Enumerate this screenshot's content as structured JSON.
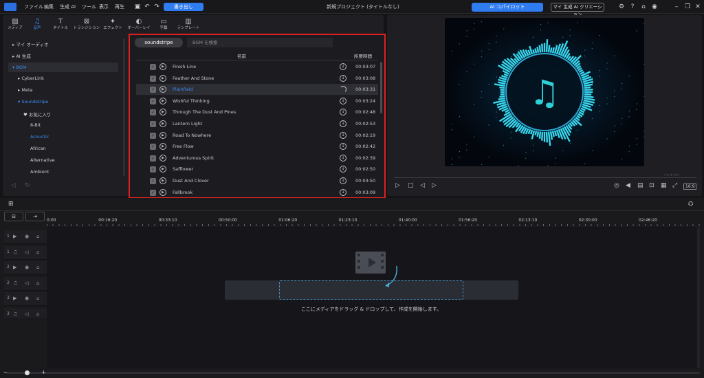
{
  "menu": [
    "ファイル",
    "編集",
    "生成 AI",
    "ツール",
    "表示",
    "再生"
  ],
  "toolbar": {
    "export_label": "書き出し"
  },
  "project_title": "新規プロジェクト (タイトルなし)",
  "ai_copilot_label": "AI コパイロット",
  "ai_creation_label": "マイ 生成 AI クリエーション",
  "tabs": [
    {
      "label": "メディア"
    },
    {
      "label": "音声"
    },
    {
      "label": "タイトル"
    },
    {
      "label": "トランジション"
    },
    {
      "label": "エフェクト"
    },
    {
      "label": "オーバーレイ"
    },
    {
      "label": "字幕"
    },
    {
      "label": "テンプレート"
    }
  ],
  "tree": [
    "マイ オーディオ",
    "AI 生成",
    "BGM",
    "CyberLink",
    "Meta",
    "Soundstripe",
    "お気に入り",
    "8-Bit",
    "Acoustic",
    "African",
    "Alternative",
    "Ambient"
  ],
  "music": {
    "brand": "soundstripe",
    "search_placeholder": "BGM を検索",
    "col_name": "名前",
    "col_duration": "所要時間",
    "rows": [
      {
        "name": "Finish Line",
        "dur": "00:03:07"
      },
      {
        "name": "Feather And Stone",
        "dur": "00:03:08"
      },
      {
        "name": "Plainfield",
        "dur": "00:03:31"
      },
      {
        "name": "Wishful Thinking",
        "dur": "00:03:24"
      },
      {
        "name": "Through The Dust And Pines",
        "dur": "00:02:48"
      },
      {
        "name": "Lantern Light",
        "dur": "00:02:53"
      },
      {
        "name": "Road To Nowhere",
        "dur": "00:02:19"
      },
      {
        "name": "Free Flow",
        "dur": "00:02:42"
      },
      {
        "name": "Adventurous Spirit",
        "dur": "00:02:39"
      },
      {
        "name": "Safflower",
        "dur": "00:02:50"
      },
      {
        "name": "Dust And Clover",
        "dur": "00:03:50"
      },
      {
        "name": "Fallbrook",
        "dur": "00:03:09"
      }
    ]
  },
  "preview": {
    "timecode": "--:--:--:--",
    "ratio": "16:9"
  },
  "timeline": {
    "ruler": [
      "0:00",
      "00:16:20",
      "00:33:10",
      "00:50:00",
      "01:06:20",
      "01:23:10",
      "01:40:00",
      "01:56:20",
      "02:13:10",
      "02:30:00",
      "02:46:20"
    ],
    "track_numbers": [
      "1",
      "1",
      "2",
      "2",
      "3",
      "3"
    ],
    "drop_text": "ここにメディアをドラッグ & ドロップして、作成を開始します。"
  },
  "colors": {
    "accent": "#3b8bf5",
    "highlight_border": "#e02020"
  }
}
